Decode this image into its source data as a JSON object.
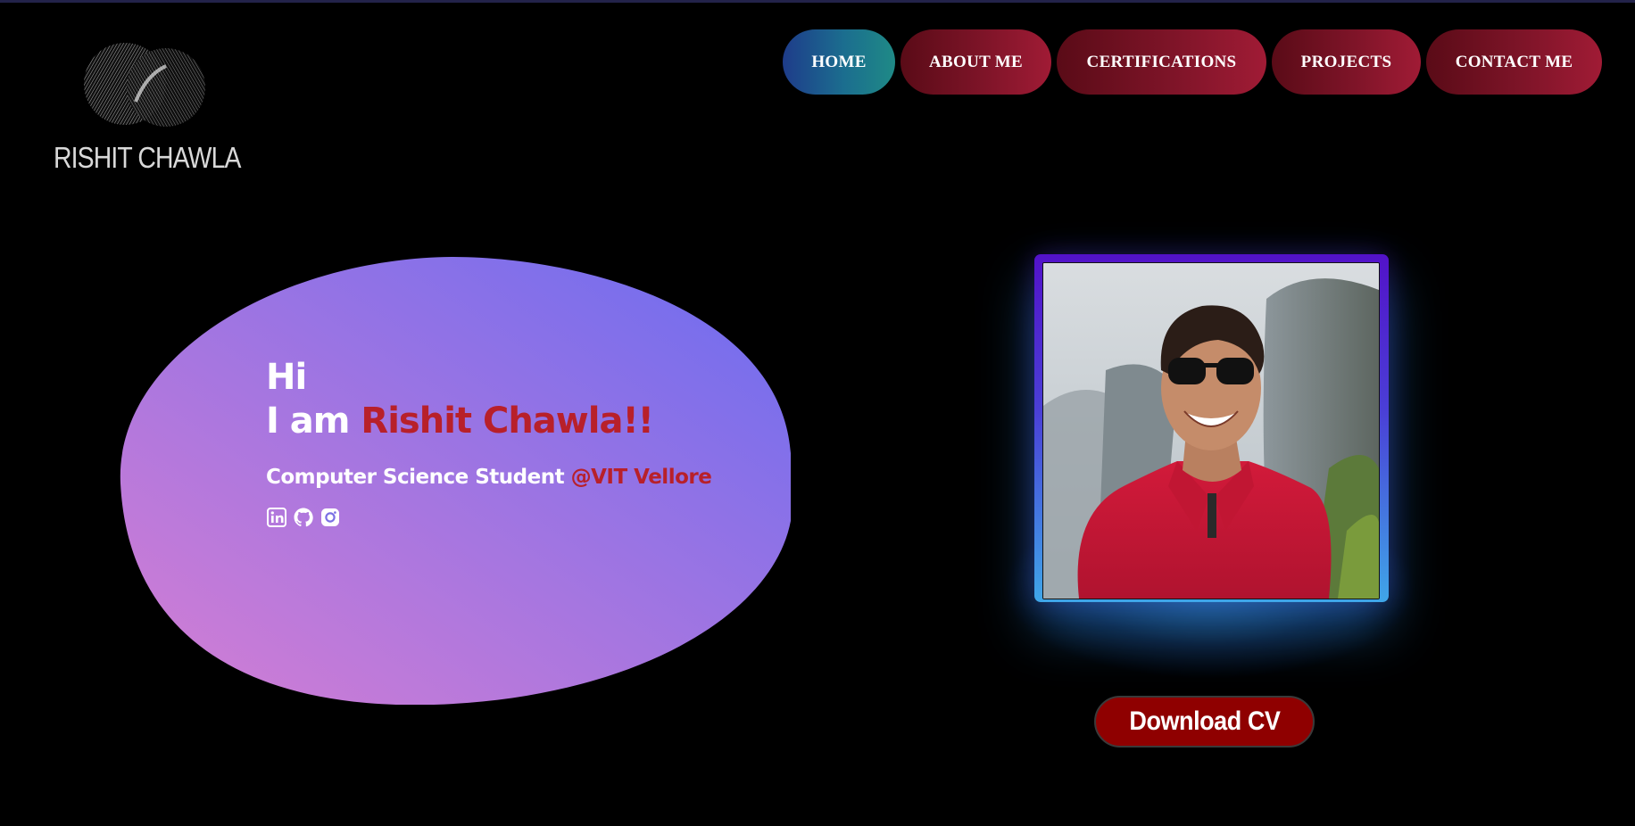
{
  "brand": {
    "name": "RISHIT CHAWLA",
    "logo_icon": "interlocking-circles-logo"
  },
  "nav": {
    "items": [
      {
        "label": "HOME",
        "active": true
      },
      {
        "label": "ABOUT ME",
        "active": false
      },
      {
        "label": "CERTIFICATIONS",
        "active": false
      },
      {
        "label": "PROJECTS",
        "active": false
      },
      {
        "label": "CONTACT ME",
        "active": false
      }
    ]
  },
  "hero": {
    "greeting": "Hi",
    "intro_prefix": "I am ",
    "name": "Rishit Chawla!!",
    "subtitle_prefix": "Computer Science Student ",
    "subtitle_highlight": "@VIT Vellore",
    "socials": [
      {
        "icon": "linkedin-icon"
      },
      {
        "icon": "github-icon"
      },
      {
        "icon": "instagram-icon"
      }
    ]
  },
  "cta": {
    "download_label": "Download CV"
  },
  "colors": {
    "background": "#000000",
    "accent_red": "#b8202a",
    "nav_active_start": "#1e3c8a",
    "nav_active_end": "#1f8a86",
    "nav_inactive_start": "#5a0b17",
    "nav_inactive_end": "#a01b35",
    "blob_start": "#d27fd2",
    "blob_end": "#6c6df0",
    "cta_background": "#8f0000"
  }
}
